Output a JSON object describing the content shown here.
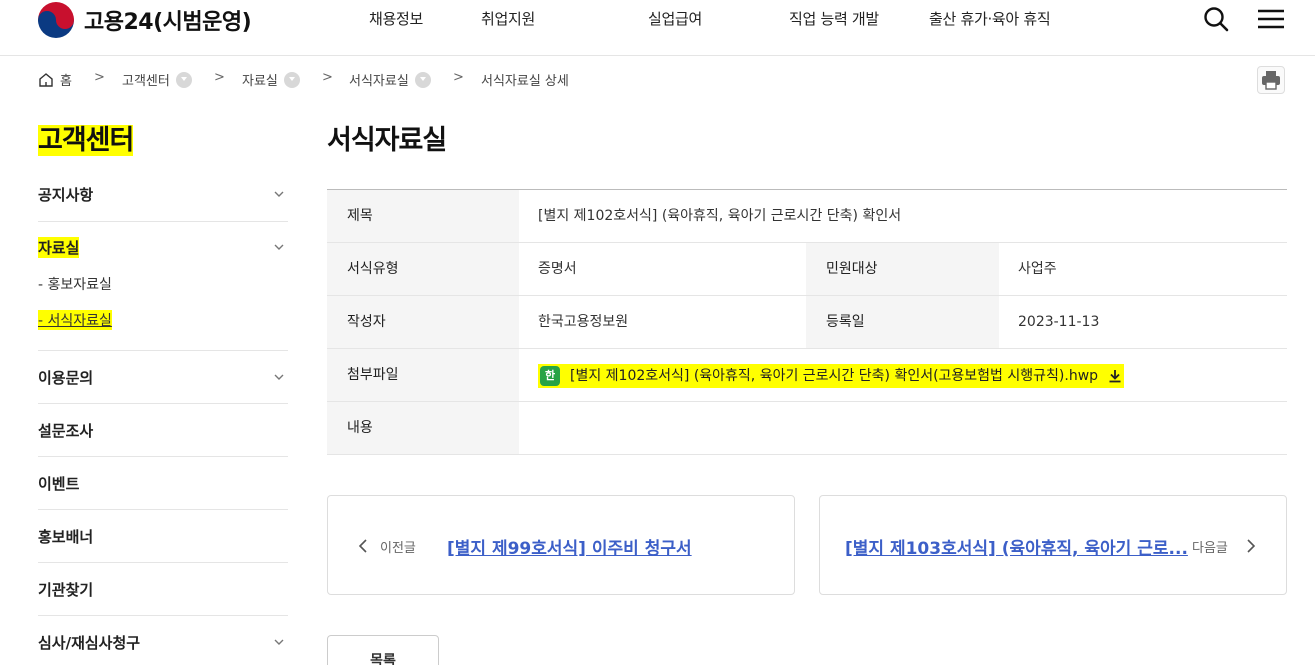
{
  "header": {
    "site_title": "고용24(시범운영)",
    "nav": [
      "채용정보",
      "취업지원",
      "실업급여",
      "직업 능력 개발",
      "출산 휴가·육아 휴직"
    ]
  },
  "breadcrumb": {
    "home": "홈",
    "items": [
      "고객센터",
      "자료실",
      "서식자료실",
      "서식자료실 상세"
    ]
  },
  "sidebar": {
    "title": "고객센터",
    "menu": [
      {
        "label": "공지사항",
        "expandable": true
      },
      {
        "label": "자료실",
        "expandable": true,
        "sub": [
          "- 홍보자료실",
          "- 서식자료실"
        ]
      },
      {
        "label": "이용문의",
        "expandable": true
      },
      {
        "label": "설문조사",
        "expandable": false
      },
      {
        "label": "이벤트",
        "expandable": false
      },
      {
        "label": "홍보배너",
        "expandable": false
      },
      {
        "label": "기관찾기",
        "expandable": false
      },
      {
        "label": "심사/재심사청구",
        "expandable": true
      }
    ]
  },
  "main": {
    "title": "서식자료실",
    "labels": {
      "subject": "제목",
      "form_type": "서식유형",
      "target": "민원대상",
      "author": "작성자",
      "reg_date": "등록일",
      "attachment": "첨부파일",
      "content": "내용"
    },
    "values": {
      "subject": "[별지 제102호서식] (육아휴직, 육아기 근로시간 단축) 확인서",
      "form_type": "증명서",
      "target": "사업주",
      "author": "한국고용정보원",
      "reg_date": "2023-11-13",
      "attachment": "[별지 제102호서식] (육아휴직, 육아기 근로시간 단축) 확인서(고용보험법 시행규칙).hwp",
      "attachment_icon_text": "한",
      "content": ""
    },
    "prev": {
      "label": "이전글",
      "title": "[별지 제99호서식] 이주비 청구서"
    },
    "next": {
      "label": "다음글",
      "title": "[별지 제103호서식] (육아휴직, 육아기 근로..."
    },
    "list_button": "목록"
  },
  "colors": {
    "highlight": "#ffff00",
    "link": "#3c5fc8",
    "file_icon": "#27a345"
  }
}
